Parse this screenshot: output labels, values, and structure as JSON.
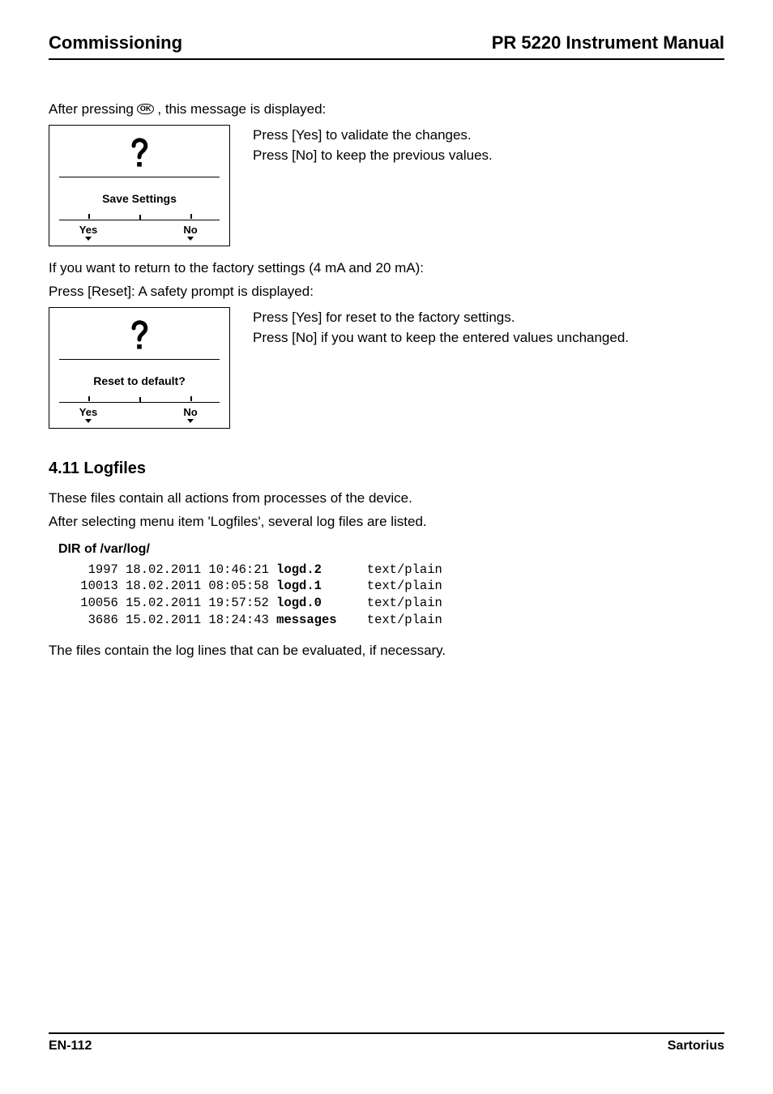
{
  "header": {
    "left": "Commissioning",
    "right": "PR 5220 Instrument Manual"
  },
  "intro": {
    "before_ok": "After pressing ",
    "ok_label": "OK",
    "after_ok": ", this message is displayed:"
  },
  "lcd1": {
    "title": "Save Settings",
    "yes": "Yes",
    "no": "No"
  },
  "side1": {
    "line1": "Press [Yes] to validate the changes.",
    "line2": "Press [No] to keep the previous values."
  },
  "mid_text": {
    "line1": "If you want to return to the factory settings (4 mA and 20 mA):",
    "line2": "Press [Reset]: A safety prompt is displayed:"
  },
  "lcd2": {
    "title": "Reset to default?",
    "yes": "Yes",
    "no": "No"
  },
  "side2": {
    "line1": "Press [Yes] for reset to the factory settings.",
    "line2": "Press [No] if you want to keep the entered values unchanged."
  },
  "section": {
    "heading": "4.11  Logfiles",
    "p1": "These files contain all actions from processes of the device.",
    "p2": "After selecting menu item 'Logfiles', several log files are listed.",
    "dir_heading": "DIR of /var/log/",
    "rows": [
      {
        "size": "1997",
        "date": "18.02.2011",
        "time": "10:46:21",
        "name": "logd.2",
        "mime": "text/plain"
      },
      {
        "size": "10013",
        "date": "18.02.2011",
        "time": "08:05:58",
        "name": "logd.1",
        "mime": "text/plain"
      },
      {
        "size": "10056",
        "date": "15.02.2011",
        "time": "19:57:52",
        "name": "logd.0",
        "mime": "text/plain"
      },
      {
        "size": "3686",
        "date": "15.02.2011",
        "time": "18:24:43",
        "name": "messages",
        "mime": "text/plain"
      }
    ],
    "p3": "The files contain the log lines that can be evaluated, if necessary."
  },
  "footer": {
    "left": "EN-112",
    "right": "Sartorius"
  }
}
